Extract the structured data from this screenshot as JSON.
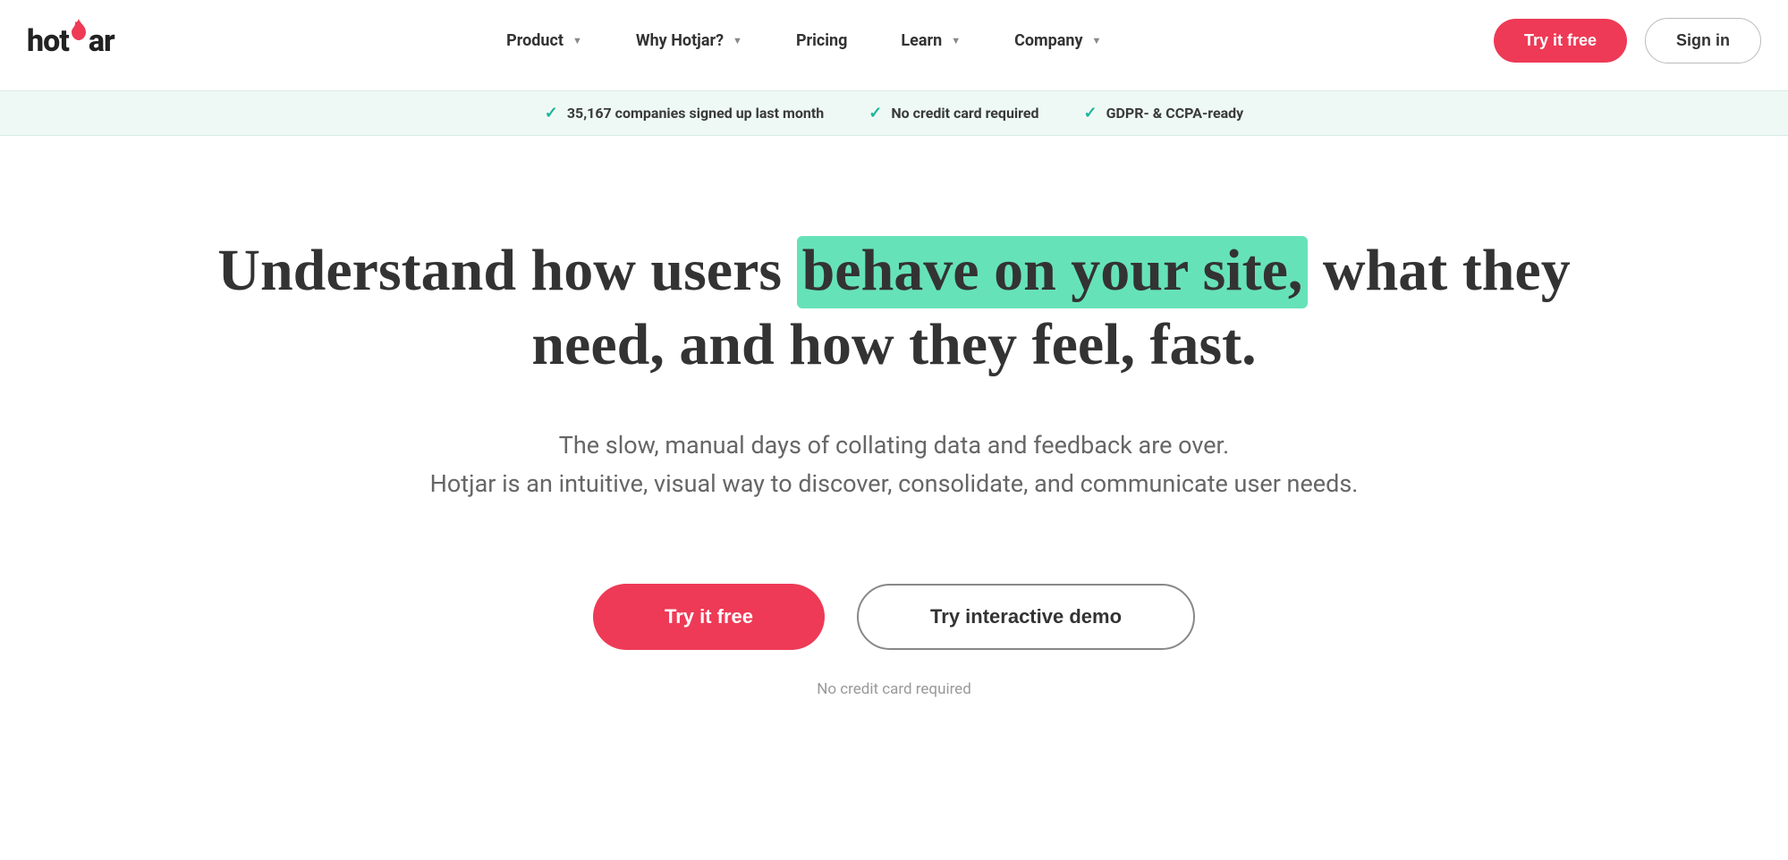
{
  "logo": {
    "text_before": "hot",
    "text_after": "ar"
  },
  "nav": {
    "items": [
      {
        "label": "Product",
        "has_dropdown": true
      },
      {
        "label": "Why Hotjar?",
        "has_dropdown": true
      },
      {
        "label": "Pricing",
        "has_dropdown": false
      },
      {
        "label": "Learn",
        "has_dropdown": true
      },
      {
        "label": "Company",
        "has_dropdown": true
      }
    ]
  },
  "header_actions": {
    "try_free": "Try it free",
    "sign_in": "Sign in"
  },
  "banner": {
    "items": [
      "35,167 companies signed up last month",
      "No credit card required",
      "GDPR- & CCPA-ready"
    ]
  },
  "hero": {
    "headline_pre": "Understand how users ",
    "headline_highlight": "behave on your site,",
    "headline_post": " what they need, and how they feel, fast.",
    "sub_line1": "The slow, manual days of collating data and feedback are over.",
    "sub_line2": "Hotjar is an intuitive, visual way to discover, consolidate, and communicate user needs.",
    "cta_primary": "Try it free",
    "cta_secondary": "Try interactive demo",
    "note": "No credit card required"
  }
}
